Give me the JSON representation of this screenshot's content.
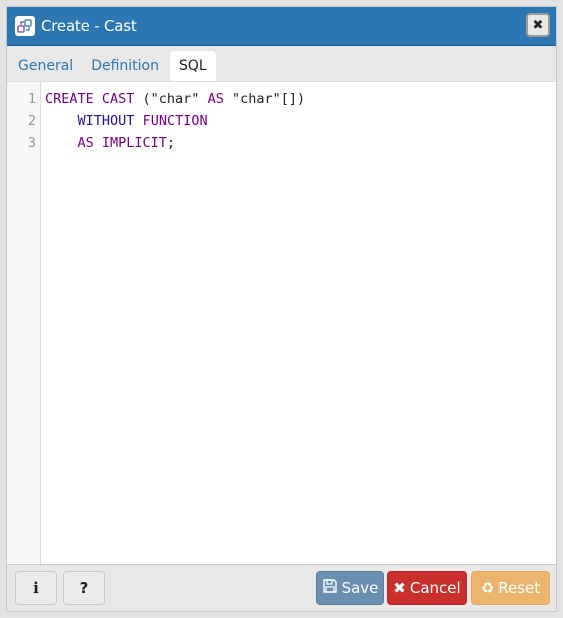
{
  "dialog": {
    "title": "Create - Cast",
    "title_icon": "cast-icon",
    "close_icon": "close-icon"
  },
  "tabs": [
    {
      "label": "General",
      "active": false
    },
    {
      "label": "Definition",
      "active": false
    },
    {
      "label": "SQL",
      "active": true
    }
  ],
  "editor": {
    "line_numbers": [
      "1",
      "2",
      "3"
    ],
    "lines": [
      [
        {
          "text": "CREATE CAST",
          "cls": "kw"
        },
        {
          "text": " (\"char\" ",
          "cls": "str"
        },
        {
          "text": "AS",
          "cls": "kw"
        },
        {
          "text": " \"char\"[])",
          "cls": "str"
        }
      ],
      [
        {
          "text": "    ",
          "cls": "str"
        },
        {
          "text": "WITHOUT",
          "cls": "kw2"
        },
        {
          "text": " ",
          "cls": "str"
        },
        {
          "text": "FUNCTION",
          "cls": "kw"
        }
      ],
      [
        {
          "text": "    ",
          "cls": "str"
        },
        {
          "text": "AS IMPLICIT",
          "cls": "kw"
        },
        {
          "text": ";",
          "cls": "str"
        }
      ]
    ]
  },
  "footer": {
    "info_label": "i",
    "help_label": "?",
    "save_label": "Save",
    "cancel_label": "Cancel",
    "reset_label": "Reset"
  },
  "colors": {
    "titlebar": "#2c76b4",
    "save": "#6a8fb1",
    "cancel": "#c9302c",
    "reset": "#ebb56f"
  }
}
